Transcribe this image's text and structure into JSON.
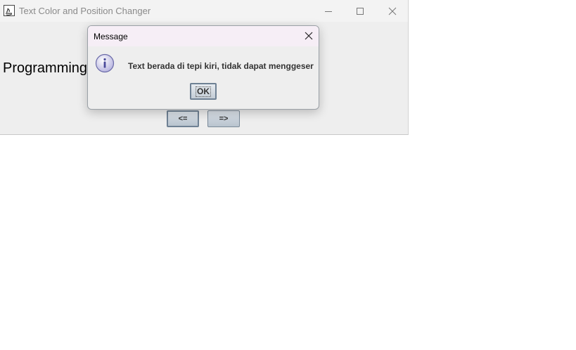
{
  "window": {
    "title": "Text Color and Position Changer",
    "icon": "java-app-icon"
  },
  "content": {
    "text": "Programming"
  },
  "buttons": {
    "left_label": "<=",
    "right_label": "=>"
  },
  "dialog": {
    "title": "Message",
    "icon": "info-icon",
    "message": "Text berada di tepi kiri, tidak dapat menggeser",
    "ok_label": "OK"
  }
}
